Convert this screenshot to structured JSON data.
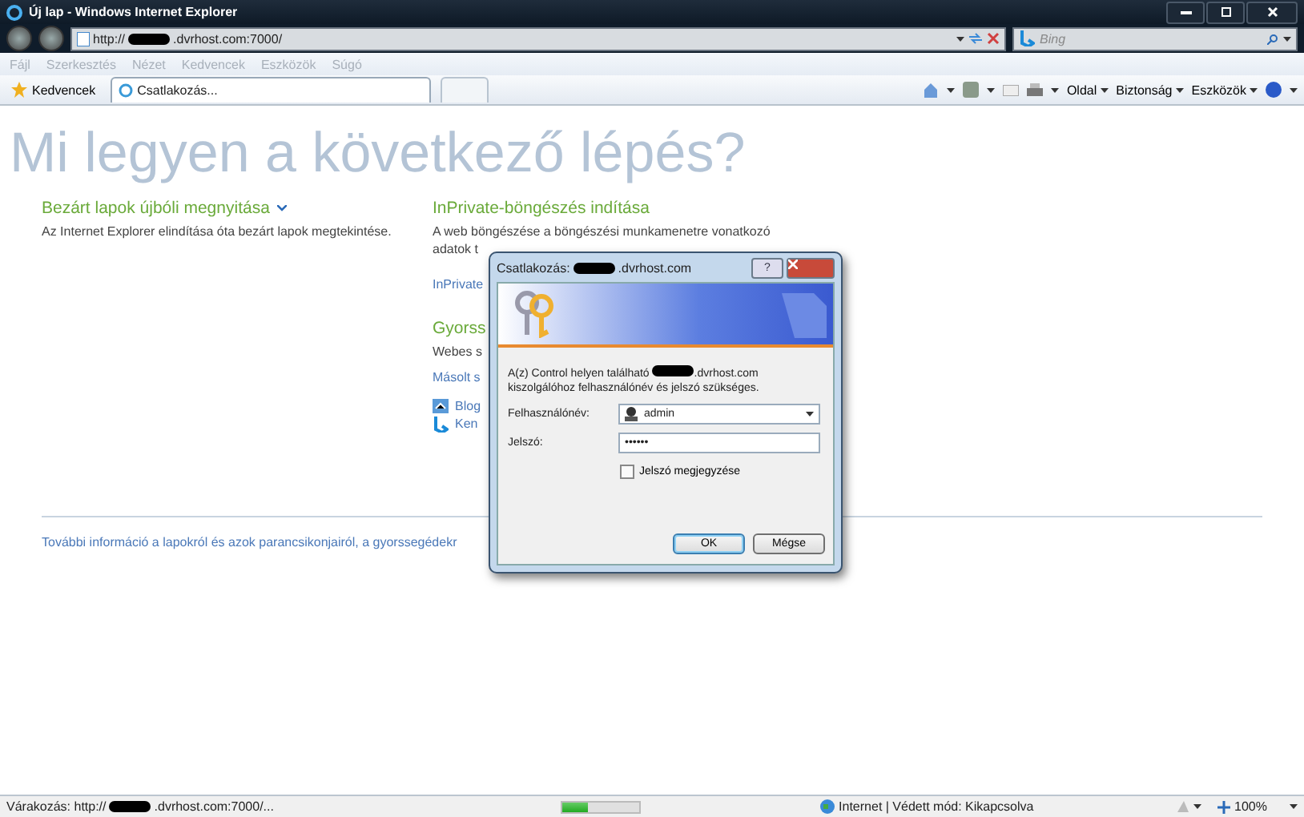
{
  "window": {
    "title": "Új lap - Windows Internet Explorer"
  },
  "address_bar": {
    "url_prefix": "http://",
    "url_suffix": ".dvrhost.com:7000/"
  },
  "search": {
    "placeholder": "Bing"
  },
  "menu": [
    "Fájl",
    "Szerkesztés",
    "Nézet",
    "Kedvencek",
    "Eszközök",
    "Súgó"
  ],
  "favorites": {
    "label": "Kedvencek"
  },
  "tabs": [
    {
      "label": "Csatlakozás...",
      "selected": true
    },
    {
      "selected": false
    }
  ],
  "command_bar": [
    "Oldal",
    "Biztonság",
    "Eszközök"
  ],
  "page": {
    "title": "Mi legyen a következő lépés?",
    "left": {
      "heading": "Bezárt lapok újbóli megnyitása",
      "description": "Az Internet Explorer elindítása óta bezárt lapok megtekintése."
    },
    "right": {
      "heading": "InPrivate-böngészés indítása",
      "description_lines": [
        "A web böngészése a böngészési munkamenetre vonatkozó",
        "adatok t"
      ],
      "link": "InPrivate",
      "heading2": "Gyorss",
      "description2": "Webes s",
      "link2": "Másolt s",
      "icon_links": [
        {
          "label": "Blog",
          "kind": "blog"
        },
        {
          "label": "Ken",
          "kind": "bing"
        }
      ]
    },
    "footer_link": "További információ a lapokról és azok parancsikonjairól, a gyorssegédekr"
  },
  "dialog": {
    "title_prefix": "Csatlakozás:",
    "title_suffix": ".dvrhost.com",
    "help_button": "?",
    "message_line1_prefix": "A(z) Control helyen található",
    "message_line1_suffix": ".dvrhost.com",
    "message_line2": "kiszolgálóhoz felhasználónév és jelszó szükséges.",
    "username_label": "Felhasználónév:",
    "username": "admin",
    "password_label": "Jelszó:",
    "password": "••••••",
    "remember": {
      "label": "Jelszó megjegyzése",
      "checked": false
    },
    "buttons": [
      "OK",
      "Mégse"
    ]
  },
  "status_bar": {
    "text_prefix": "Várakozás: http://",
    "text_suffix": ".dvrhost.com:7000/...",
    "level": 0.35,
    "zone": "Internet | Védett mód: Kikapcsolva",
    "zoom": "100%"
  }
}
